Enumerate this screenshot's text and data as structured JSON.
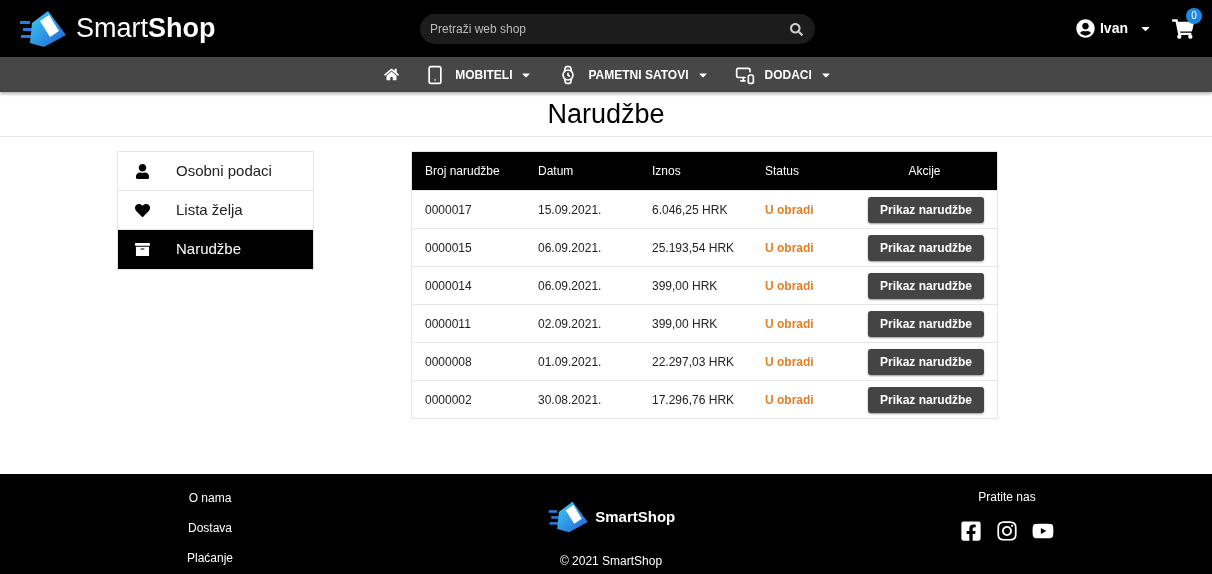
{
  "header": {
    "logo": "Smart**Shop**",
    "search": {
      "placeholder": "Pretraži web shop"
    },
    "user": "Ivan",
    "cart_count": "0"
  },
  "nav": {
    "items": [
      {
        "kind": "home"
      },
      {
        "kind": "phone",
        "label": "MOBITELI"
      },
      {
        "kind": "watch",
        "label": "PAMETNI SATOVI"
      },
      {
        "kind": "devices",
        "label": "DODACI"
      }
    ]
  },
  "page_title": "Narudžbe",
  "sidebar": {
    "items": [
      {
        "kind": "user",
        "label": "Osobni podaci",
        "selected": false
      },
      {
        "kind": "heart",
        "label": "Lista želja",
        "selected": false
      },
      {
        "kind": "archive",
        "label": "Narudžbe",
        "selected": true
      }
    ]
  },
  "table": {
    "columns": [
      "Broj narudžbe",
      "Datum",
      "Iznos",
      "Status",
      "Akcije"
    ],
    "rows": [
      {
        "number": "0000017",
        "date": "15.09.2021.",
        "amount": "6.046,25 HRK",
        "status": "U obradi",
        "action": "Prikaz narudžbe"
      },
      {
        "number": "0000015",
        "date": "06.09.2021.",
        "amount": "25.193,54 HRK",
        "status": "U obradi",
        "action": "Prikaz narudžbe"
      },
      {
        "number": "0000014",
        "date": "06.09.2021.",
        "amount": "399,00 HRK",
        "status": "U obradi",
        "action": "Prikaz narudžbe"
      },
      {
        "number": "0000011",
        "date": "02.09.2021.",
        "amount": "399,00 HRK",
        "status": "U obradi",
        "action": "Prikaz narudžbe"
      },
      {
        "number": "0000008",
        "date": "01.09.2021.",
        "amount": "22.297,03 HRK",
        "status": "U obradi",
        "action": "Prikaz narudžbe"
      },
      {
        "number": "0000002",
        "date": "30.08.2021.",
        "amount": "17.296,76 HRK",
        "status": "U obradi",
        "action": "Prikaz narudžbe"
      }
    ]
  },
  "footer": {
    "links": [
      "O nama",
      "Dostava",
      "Plaćanje"
    ],
    "logo": "SmartShop",
    "follow": "Pratite nas",
    "copyright": "© 2021 SmartShop"
  }
}
